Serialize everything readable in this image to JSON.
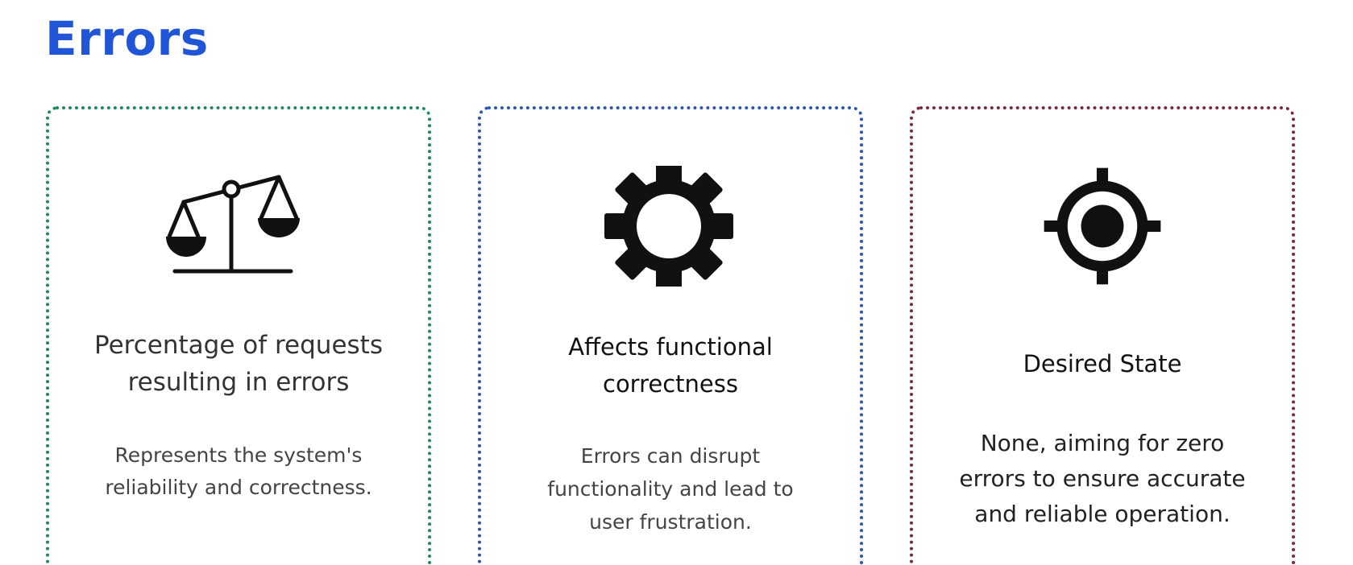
{
  "page": {
    "title": "Errors"
  },
  "colors": {
    "title": "#1f55d6",
    "card_1_border": "#1f8a5b",
    "card_2_border": "#2a56b4",
    "card_3_border": "#7a2a3c",
    "icon": "#111111"
  },
  "cards": [
    {
      "icon": "balance-scale-icon",
      "heading_line1": "Percentage of requests",
      "heading_line2": "resulting in errors",
      "desc_line1": "Represents the system's",
      "desc_line2": "reliability and correctness."
    },
    {
      "icon": "gear-icon",
      "heading_line1": "Affects functional",
      "heading_line2": "correctness",
      "desc_line1": "Errors can disrupt",
      "desc_line2": "functionality and lead to",
      "desc_line3": "user frustration."
    },
    {
      "icon": "target-icon",
      "heading_line1": "Desired State",
      "desc_line1": "None, aiming for zero",
      "desc_line2": "errors to ensure accurate",
      "desc_line3": "and reliable operation."
    }
  ]
}
